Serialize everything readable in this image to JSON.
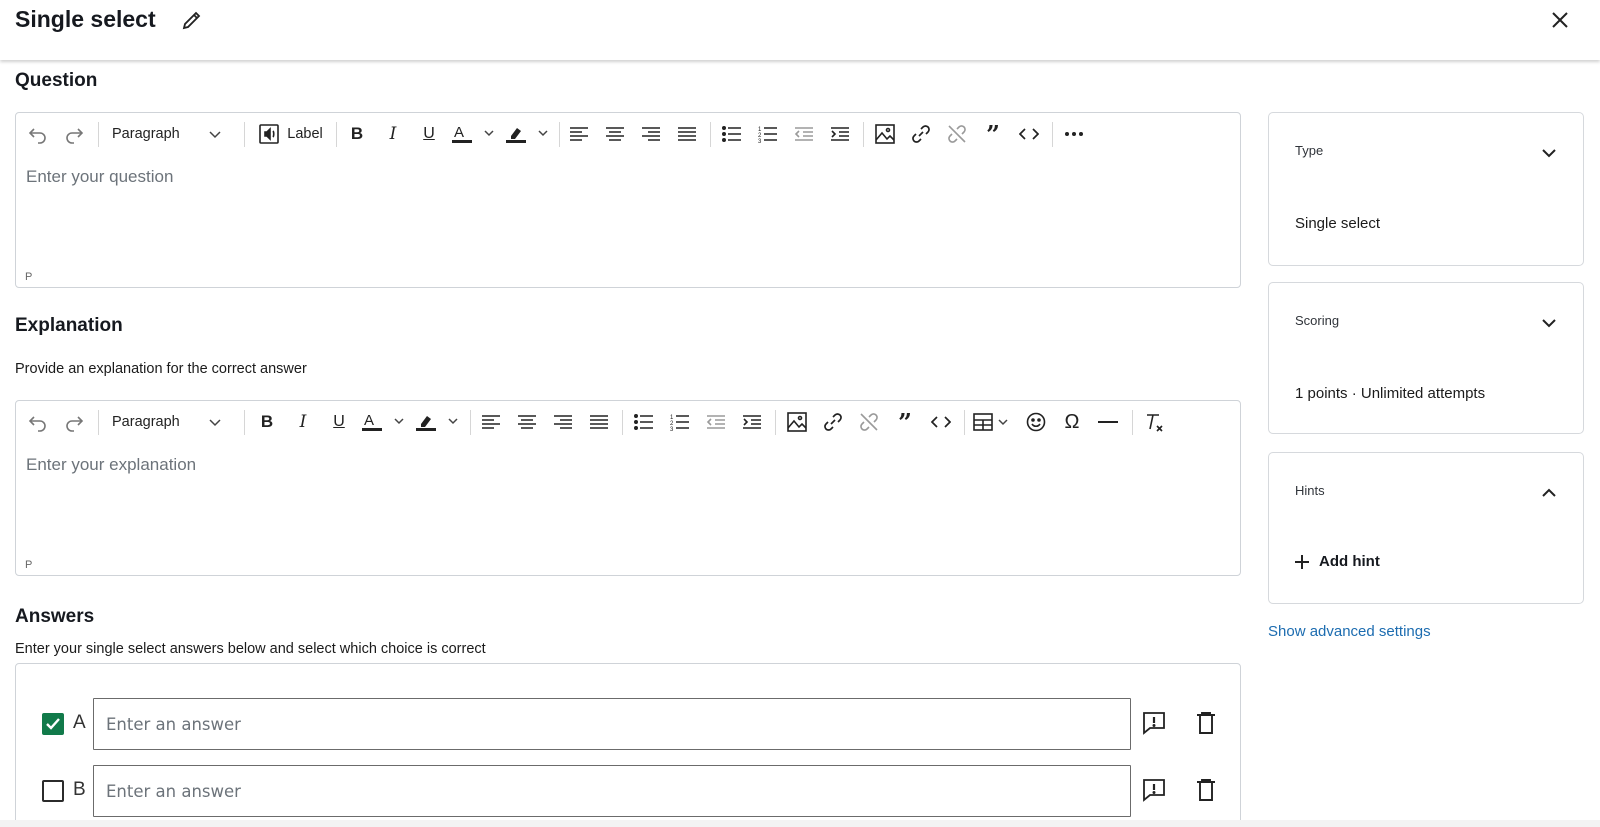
{
  "header": {
    "title": "Single select"
  },
  "question": {
    "title": "Question",
    "placeholder": "Enter your question",
    "block_type": "Paragraph",
    "label_button": "Label",
    "status_tag": "P"
  },
  "explanation": {
    "title": "Explanation",
    "description": "Provide an explanation for the correct answer",
    "placeholder": "Enter your explanation",
    "block_type": "Paragraph",
    "status_tag": "P"
  },
  "answers": {
    "title": "Answers",
    "description": "Enter your single select answers below and select which choice is correct",
    "items": [
      {
        "letter": "A",
        "placeholder": "Enter an answer",
        "correct": true
      },
      {
        "letter": "B",
        "placeholder": "Enter an answer",
        "correct": false
      }
    ]
  },
  "sidebar": {
    "type": {
      "label": "Type",
      "value": "Single select"
    },
    "scoring": {
      "label": "Scoring",
      "value": "1 points · Unlimited attempts"
    },
    "hints": {
      "label": "Hints",
      "add_label": "Add hint"
    },
    "advanced_link": "Show advanced settings"
  },
  "colors": {
    "checkbox_checked": "#117a4a",
    "link": "#1c6cb0"
  }
}
